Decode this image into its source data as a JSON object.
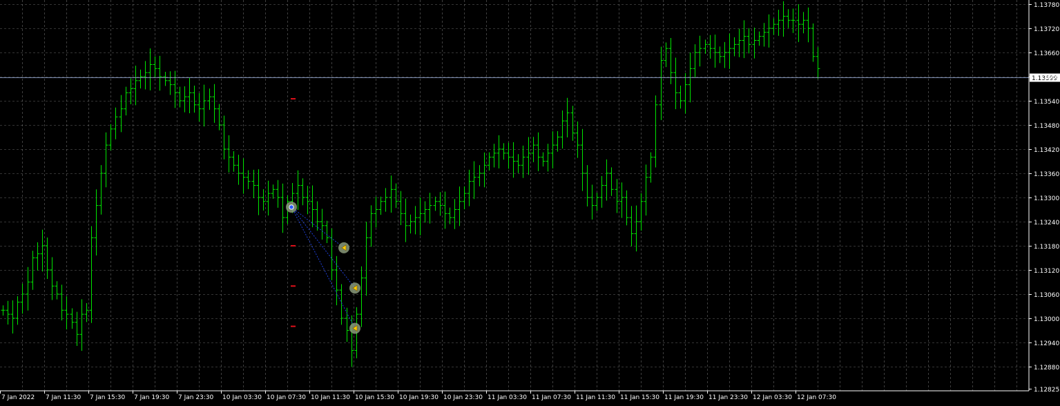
{
  "colors": {
    "background": "#000000",
    "grid": "#c0c0c0",
    "bars": "#00e600",
    "axis": "#ffffff",
    "bid_line": "#7f8fb3",
    "price_label_bg": "#ffffff",
    "price_label_text": "#000000",
    "trade_line": "#1e3fd8",
    "order_dash": "#e0101a"
  },
  "chart_data": {
    "type": "ohlc",
    "symbol_timeframe": "H1",
    "grid": true,
    "ylim": [
      1.12825,
      1.1378
    ],
    "y_ticks": [
      "1.13780",
      "1.13720",
      "1.13660",
      "1.13600",
      "1.13540",
      "1.13480",
      "1.13420",
      "1.13360",
      "1.13300",
      "1.13240",
      "1.13180",
      "1.13120",
      "1.13060",
      "1.13000",
      "1.12940",
      "1.12880",
      "1.12825"
    ],
    "x_ticks": [
      "7 Jan 2022",
      "7 Jan 11:30",
      "7 Jan 15:30",
      "7 Jan 19:30",
      "7 Jan 23:30",
      "10 Jan 03:30",
      "10 Jan 07:30",
      "10 Jan 11:30",
      "10 Jan 15:30",
      "10 Jan 19:30",
      "10 Jan 23:30",
      "11 Jan 03:30",
      "11 Jan 07:30",
      "11 Jan 11:30",
      "11 Jan 15:30",
      "11 Jan 19:30",
      "11 Jan 23:30",
      "12 Jan 03:30",
      "12 Jan 07:30"
    ],
    "current_price": "1.13599",
    "closes": [
      1.1302,
      1.1301,
      1.13,
      1.1304,
      1.1306,
      1.1309,
      1.1315,
      1.1316,
      1.1318,
      1.1312,
      1.1308,
      1.1306,
      1.1302,
      1.1301,
      1.1299,
      1.1296,
      1.1301,
      1.1302,
      1.132,
      1.1328,
      1.1336,
      1.1343,
      1.1347,
      1.135,
      1.1352,
      1.1356,
      1.1357,
      1.1359,
      1.136,
      1.1361,
      1.1363,
      1.1362,
      1.136,
      1.1359,
      1.1358,
      1.1356,
      1.1354,
      1.1355,
      1.1356,
      1.1353,
      1.1352,
      1.1354,
      1.1355,
      1.1352,
      1.1348,
      1.1342,
      1.134,
      1.1338,
      1.1336,
      1.1335,
      1.1334,
      1.1333,
      1.133,
      1.1329,
      1.1331,
      1.1332,
      1.133,
      1.1325,
      1.1329,
      1.1331,
      1.1333,
      1.133,
      1.1329,
      1.1327,
      1.1324,
      1.1323,
      1.132,
      1.1312,
      1.1307,
      1.13,
      1.1297,
      1.1292,
      1.1301,
      1.131,
      1.132,
      1.1326,
      1.1327,
      1.1329,
      1.133,
      1.1332,
      1.1329,
      1.1326,
      1.1323,
      1.1324,
      1.1325,
      1.1326,
      1.1327,
      1.1328,
      1.1329,
      1.1328,
      1.1326,
      1.1325,
      1.1327,
      1.1329,
      1.1331,
      1.1334,
      1.1335,
      1.1336,
      1.1338,
      1.134,
      1.1341,
      1.1342,
      1.1341,
      1.134,
      1.1339,
      1.1338,
      1.134,
      1.1341,
      1.1343,
      1.134,
      1.1339,
      1.1341,
      1.1343,
      1.1345,
      1.1349,
      1.1351,
      1.1346,
      1.1343,
      1.1336,
      1.133,
      1.1328,
      1.133,
      1.1333,
      1.1336,
      1.1332,
      1.1329,
      1.133,
      1.1325,
      1.1321,
      1.1324,
      1.1329,
      1.1335,
      1.134,
      1.1353,
      1.1364,
      1.1367,
      1.1361,
      1.1356,
      1.1354,
      1.1358,
      1.1362,
      1.1366,
      1.1367,
      1.1368,
      1.1367,
      1.1366,
      1.1365,
      1.1366,
      1.1367,
      1.1368,
      1.1369,
      1.137,
      1.1368,
      1.1369,
      1.137,
      1.1371,
      1.1372,
      1.1373,
      1.1374,
      1.1375,
      1.1374,
      1.1374,
      1.1373,
      1.1374,
      1.1372,
      1.1365,
      1.1362
    ]
  },
  "trade_markers": [
    {
      "kind": "entry",
      "price": 1.13276
    },
    {
      "kind": "tp",
      "price": 1.13175
    },
    {
      "kind": "tp",
      "price": 1.13075
    },
    {
      "kind": "tp",
      "price": 1.12975
    }
  ],
  "order_levels": [
    1.13545,
    1.1318,
    1.1308,
    1.1298
  ]
}
